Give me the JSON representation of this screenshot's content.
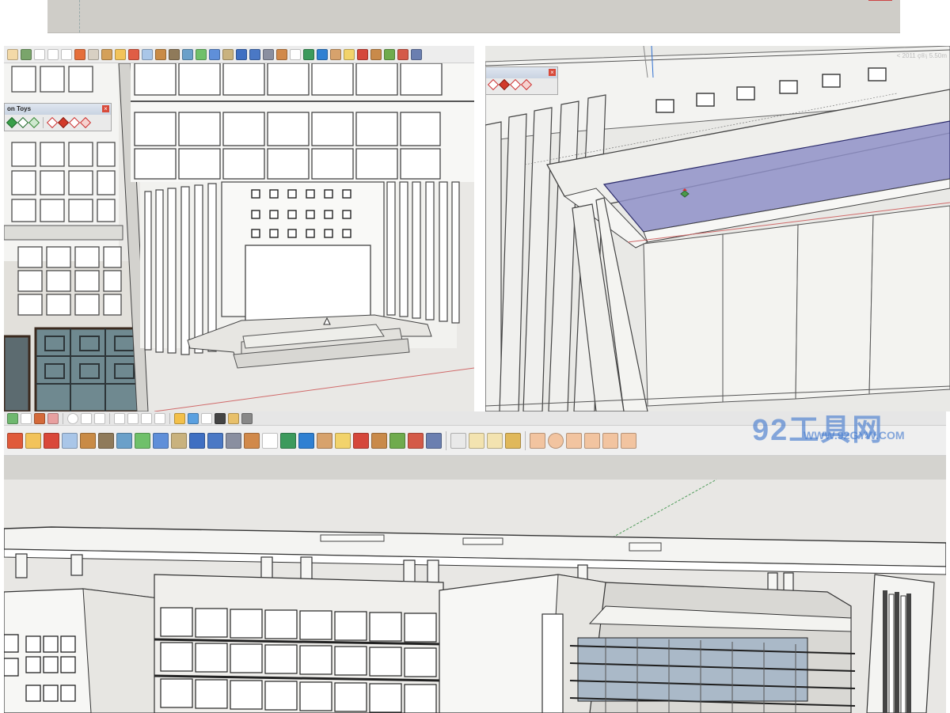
{
  "top_strip": {
    "fill": "#cfcdc8"
  },
  "panel_a": {
    "palette_title": "on Toys"
  },
  "panel_b": {
    "corner_text": "< 2011 ç®¡ 5.50m"
  },
  "panel_c": {
    "watermark_logo": "92工具网",
    "watermark_url": "WWW.92GYW.COM"
  },
  "colors": {
    "toolbar_bg": "#ededed",
    "viewport_bg": "#e8e7e4",
    "selection_blue": "#8f90c8",
    "glass_blue": "#aab9c8"
  }
}
